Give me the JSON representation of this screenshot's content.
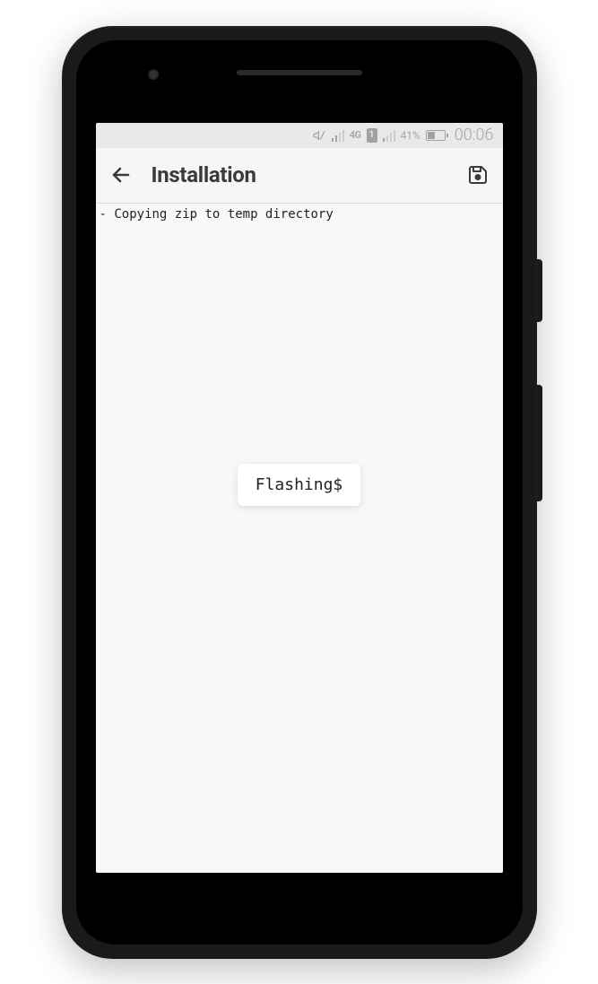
{
  "statusbar": {
    "network_label": "4G",
    "sim_number": "1",
    "battery_percent": "41%",
    "clock": "00:06"
  },
  "appbar": {
    "title": "Installation"
  },
  "log": {
    "line1": "- Copying zip to temp directory"
  },
  "toast": {
    "text": "Flashing$"
  }
}
